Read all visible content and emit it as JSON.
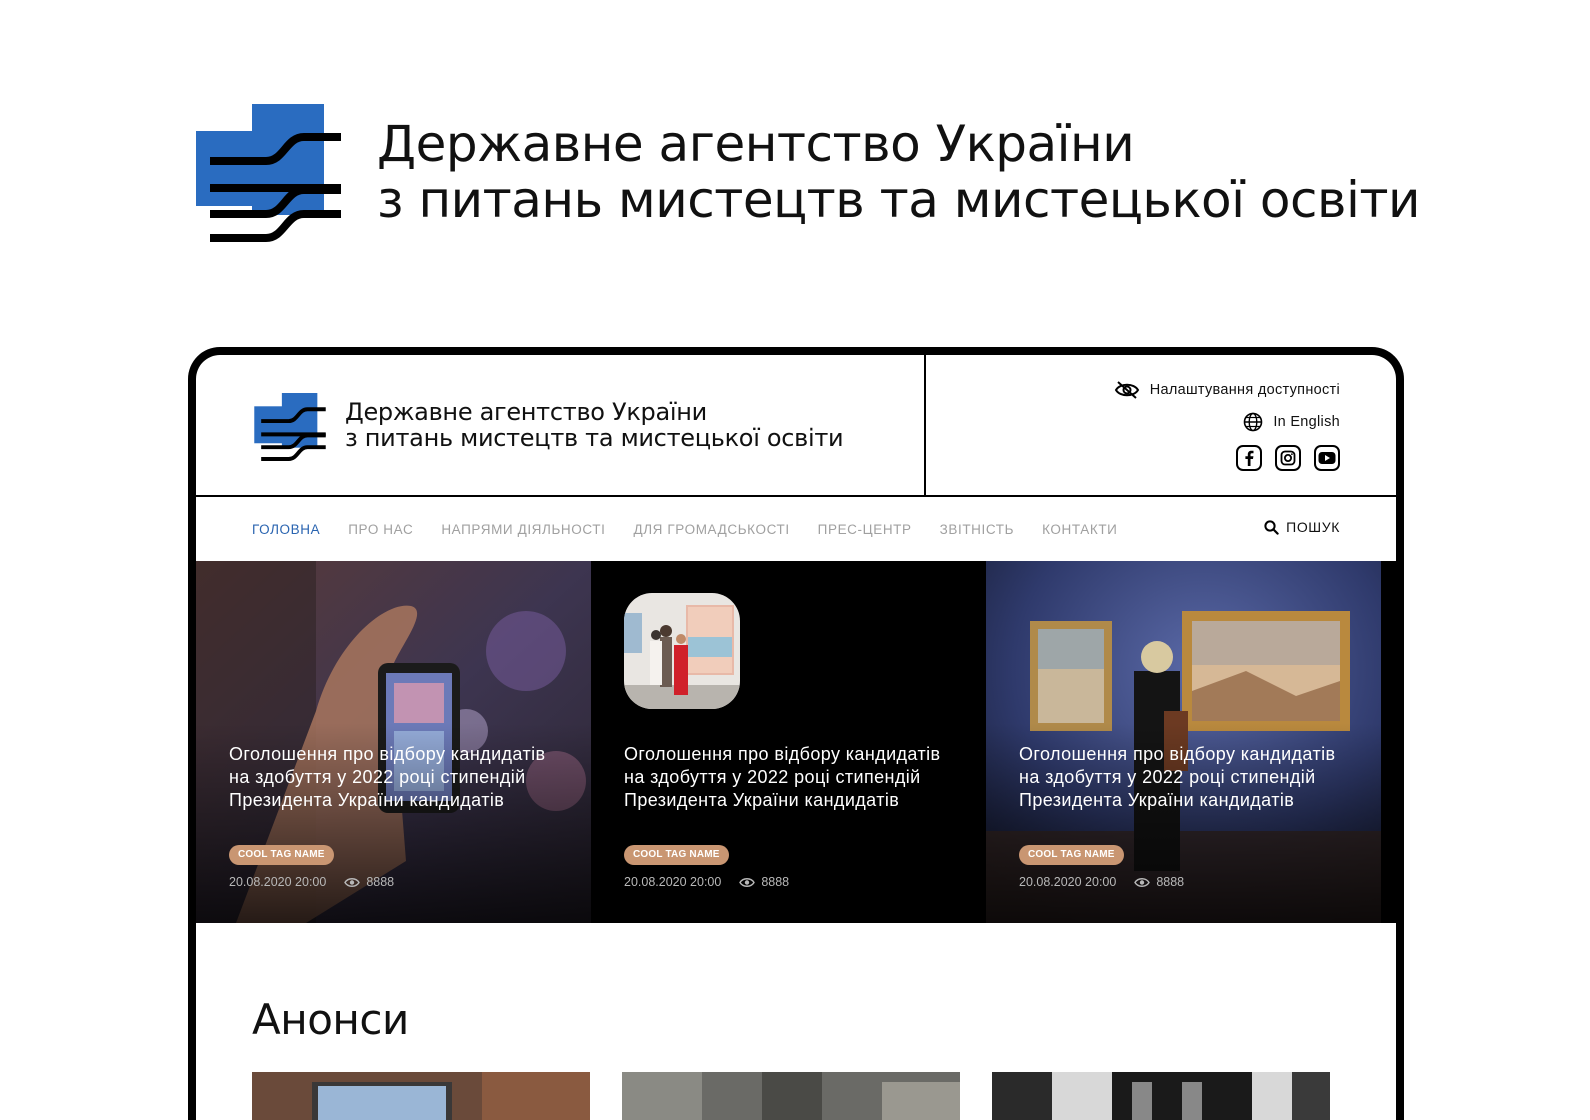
{
  "brand": {
    "title_line1": "Державне агентство України",
    "title_line2": "з питань мистецтв та мистецької освіти",
    "logo_icon": "agency-logo-icon",
    "colors": {
      "blue": "#2a6cc0",
      "ink": "#000000"
    }
  },
  "site": {
    "header": {
      "title_line1": "Державне агентство України",
      "title_line2": "з питань мистецтв та мистецької освіти",
      "accessibility_label": "Налаштування доступності",
      "language_label": "In English",
      "socials": [
        "facebook-icon",
        "instagram-icon",
        "youtube-icon"
      ]
    },
    "nav": {
      "items": [
        "ГОЛОВНА",
        "ПРО НАС",
        "НАПРЯМИ ДІЯЛЬНОСТІ",
        "ДЛЯ ГРОМАДСЬКОСТІ",
        "ПРЕС-ЦЕНТР",
        "ЗВІТНІСТЬ",
        "КОНТАКТИ"
      ],
      "active_index": 0,
      "active_color": "#2a64b0",
      "search_label": "ПОШУК"
    },
    "news_cards": [
      {
        "title": "Оголошення про відбору кандидатів на здобуття у 2022 році стипендій Президента України кандидатів",
        "tag": "COOL TAG NAME",
        "date": "20.08.2020 20:00",
        "views": "8888"
      },
      {
        "title": "Оголошення про відбору кандидатів на здобуття у 2022 році стипендій Президента України кандидатів",
        "tag": "COOL TAG NAME",
        "date": "20.08.2020 20:00",
        "views": "8888"
      },
      {
        "title": "Оголошення про відбору кандидатів на здобуття у 2022 році стипендій Президента України кандидатів",
        "tag": "COOL TAG NAME",
        "date": "20.08.2020 20:00",
        "views": "8888"
      }
    ],
    "tag_color": "#c99672",
    "announcements_title": "Анонси"
  }
}
